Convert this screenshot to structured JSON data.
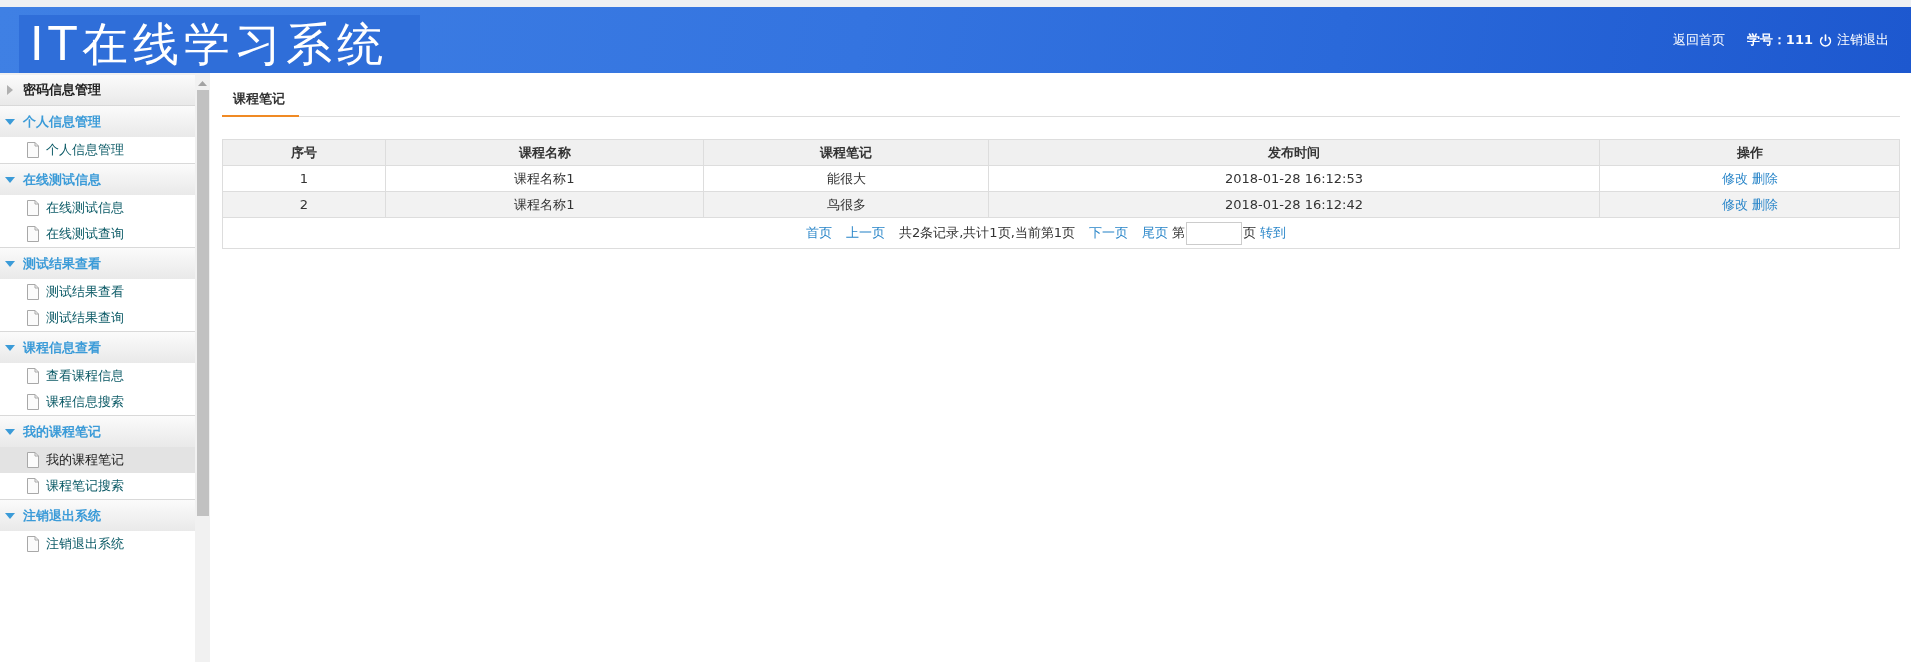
{
  "header": {
    "logo": "IT在线学习系统",
    "home_link": "返回首页",
    "student_id": "学号：111",
    "logout": "注销退出"
  },
  "sidebar": {
    "groups": [
      {
        "title": "密码信息管理",
        "expanded": false
      },
      {
        "title": "个人信息管理",
        "expanded": true,
        "items": [
          {
            "label": "个人信息管理",
            "selected": false
          }
        ]
      },
      {
        "title": "在线测试信息",
        "expanded": true,
        "items": [
          {
            "label": "在线测试信息",
            "selected": false
          },
          {
            "label": "在线测试查询",
            "selected": false
          }
        ]
      },
      {
        "title": "测试结果查看",
        "expanded": true,
        "items": [
          {
            "label": "测试结果查看",
            "selected": false
          },
          {
            "label": "测试结果查询",
            "selected": false
          }
        ]
      },
      {
        "title": "课程信息查看",
        "expanded": true,
        "items": [
          {
            "label": "查看课程信息",
            "selected": false
          },
          {
            "label": "课程信息搜索",
            "selected": false
          }
        ]
      },
      {
        "title": "我的课程笔记",
        "expanded": true,
        "items": [
          {
            "label": "我的课程笔记",
            "selected": true
          },
          {
            "label": "课程笔记搜索",
            "selected": false
          }
        ]
      },
      {
        "title": "注销退出系统",
        "expanded": true,
        "items": [
          {
            "label": "注销退出系统",
            "selected": false
          }
        ]
      }
    ]
  },
  "tabs": [
    {
      "label": "课程笔记",
      "selected": true
    }
  ],
  "table": {
    "columns": [
      "序号",
      "课程名称",
      "课程笔记",
      "发布时间",
      "操作"
    ],
    "rows": [
      {
        "cells": [
          "1",
          "课程名称1",
          "能很大",
          "2018-01-28 16:12:53"
        ],
        "actions": [
          "修改",
          "删除"
        ]
      },
      {
        "cells": [
          "2",
          "课程名称1",
          "鸟很多",
          "2018-01-28 16:12:42"
        ],
        "actions": [
          "修改",
          "删除"
        ]
      }
    ]
  },
  "pagination": {
    "first": "首页",
    "prev": "上一页",
    "summary": "共2条记录,共计1页,当前第1页",
    "next": "下一页",
    "last": "尾页",
    "page_prefix": "第",
    "page_suffix": "页",
    "go": "转到"
  }
}
